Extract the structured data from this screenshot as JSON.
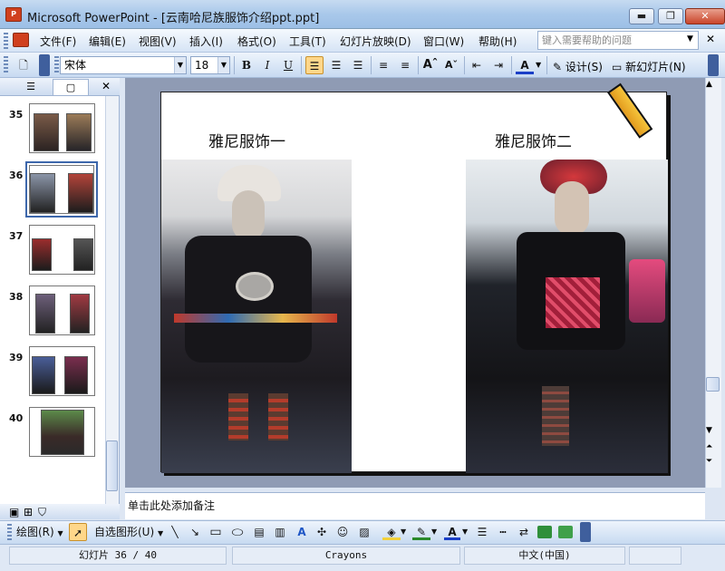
{
  "titlebar": {
    "title": "Microsoft PowerPoint - [云南哈尼族服饰介绍ppt.ppt]",
    "icon_label": "P",
    "min": "▬",
    "max": "❐",
    "close": "✕"
  },
  "menu": {
    "items": [
      "文件(F)",
      "编辑(E)",
      "视图(V)",
      "插入(I)",
      "格式(O)",
      "工具(T)",
      "幻灯片放映(D)",
      "窗口(W)",
      "帮助(H)"
    ],
    "help_placeholder": "键入需要帮助的问题"
  },
  "toolbar": {
    "font": "宋体",
    "size": "18",
    "bold": "B",
    "italic": "I",
    "underline": "U",
    "design": "设计(S)",
    "new_slide": "新幻灯片(N)"
  },
  "slides_pane": {
    "thumbnails": [
      {
        "num": "35"
      },
      {
        "num": "36"
      },
      {
        "num": "37"
      },
      {
        "num": "38"
      },
      {
        "num": "39"
      },
      {
        "num": "40"
      }
    ],
    "selected": "36"
  },
  "slide": {
    "caption_left": "雅尼服饰一",
    "caption_right": "雅尼服饰二"
  },
  "notes": {
    "placeholder": "单击此处添加备注"
  },
  "drawbar": {
    "draw": "绘图(R)",
    "autoshape": "自选图形(U)"
  },
  "status": {
    "slide_pos": "幻灯片 36 / 40",
    "design": "Crayons",
    "language": "中文(中国)"
  },
  "colors": {
    "titlebar": "#a9c8ea",
    "workspace": "#8f9bb4",
    "accent_selected": "#ffd78a"
  }
}
